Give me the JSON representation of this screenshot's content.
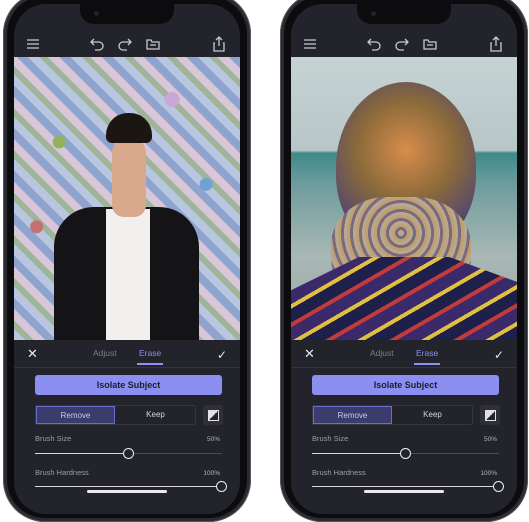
{
  "phones": [
    {
      "photo": "portrait-young-man-mosaic-background",
      "tabs": {
        "adjust": "Adjust",
        "erase": "Erase",
        "active": "erase"
      },
      "isolate_label": "Isolate Subject",
      "mode": {
        "remove": "Remove",
        "keep": "Keep",
        "selected": "remove"
      },
      "brush_size": {
        "label": "Brush Size",
        "value_text": "50%",
        "value": 50
      },
      "brush_hardness": {
        "label": "Brush Hardness",
        "value_text": "100%",
        "value": 100
      }
    },
    {
      "photo": "portrait-bearded-man-stylized-beach",
      "tabs": {
        "adjust": "Adjust",
        "erase": "Erase",
        "active": "erase"
      },
      "isolate_label": "Isolate Subject",
      "mode": {
        "remove": "Remove",
        "keep": "Keep",
        "selected": "remove"
      },
      "brush_size": {
        "label": "Brush Size",
        "value_text": "50%",
        "value": 50
      },
      "brush_hardness": {
        "label": "Brush Hardness",
        "value_text": "100%",
        "value": 100
      }
    }
  ],
  "icons": [
    "menu-icon",
    "undo-icon",
    "redo-icon",
    "folder-icon",
    "share-icon",
    "close-icon",
    "check-icon",
    "mask-icon"
  ],
  "colors": {
    "accent": "#8a8ff0",
    "background": "#23242b"
  }
}
